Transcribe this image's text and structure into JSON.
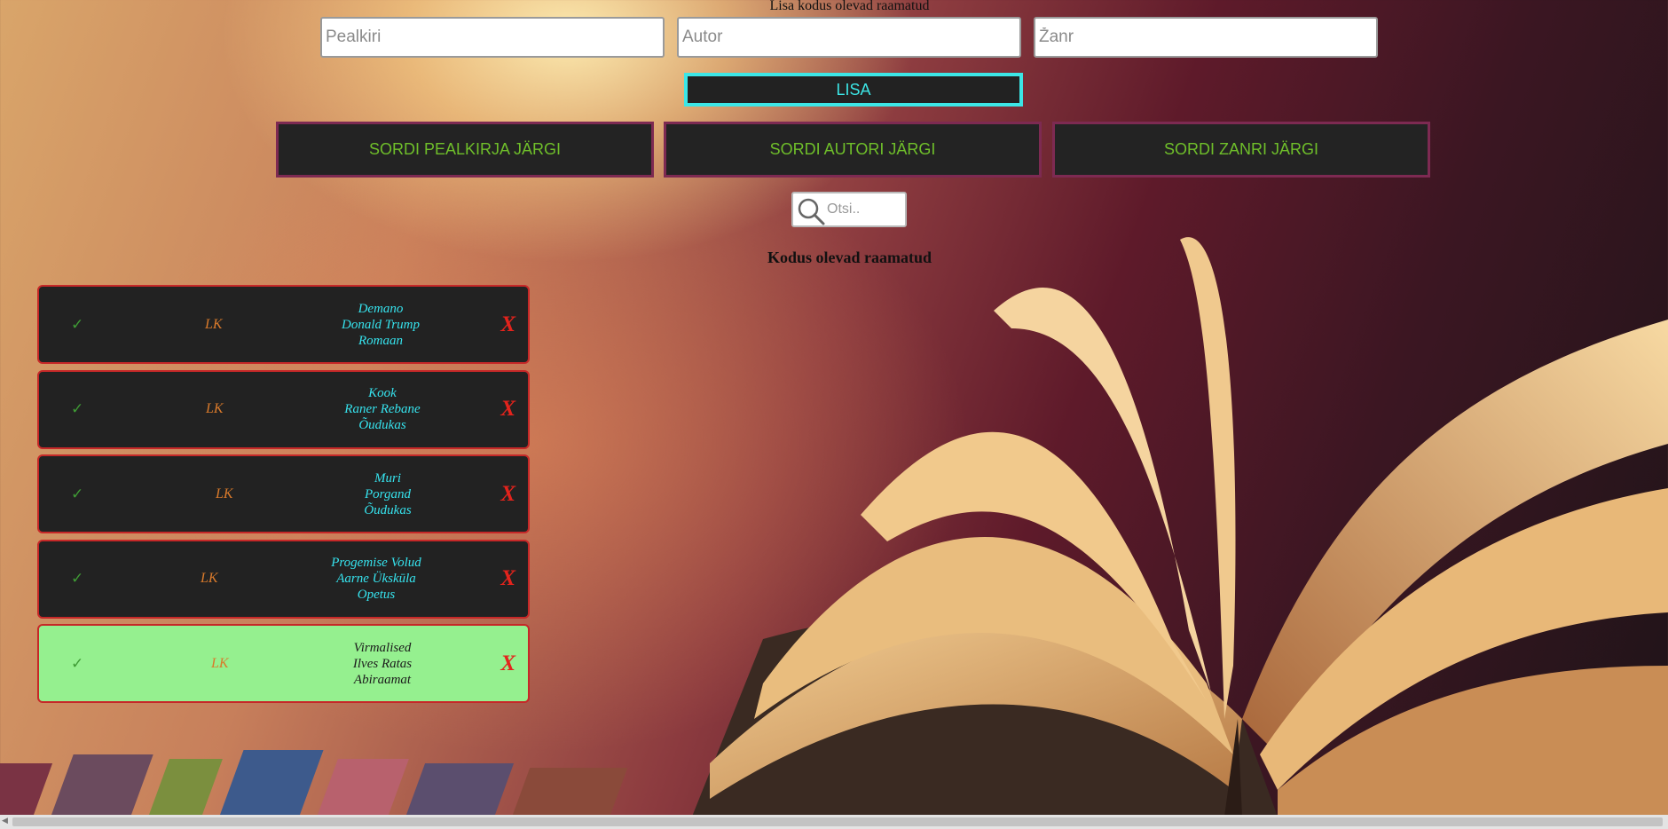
{
  "form": {
    "heading": "Lisa kodus olevad raamatud",
    "title_placeholder": "Pealkiri",
    "author_placeholder": "Autor",
    "genre_placeholder": "Žanr",
    "add_label": "LISA"
  },
  "sort": {
    "by_title": "SORDI PEALKIRJA JÄRGI",
    "by_author": "SORDI AUTORI JÄRGI",
    "by_genre": "SORDI ZANRI JÄRGI"
  },
  "search": {
    "placeholder": "Otsi..",
    "icon": "search-icon"
  },
  "list": {
    "heading": "Kodus olevad raamatud",
    "books": [
      {
        "check": "✓",
        "lk": "LK",
        "title": "Demano",
        "author": "Donald Trump",
        "genre": "Romaan",
        "delete": "X",
        "done": false
      },
      {
        "check": "✓",
        "lk": "LK",
        "title": "Kook",
        "author": "Raner Rebane",
        "genre": "Õudukas",
        "delete": "X",
        "done": false
      },
      {
        "check": "✓",
        "lk": "LK",
        "title": "Muri",
        "author": "Porgand",
        "genre": "Õudukas",
        "delete": "X",
        "done": false
      },
      {
        "check": "✓",
        "lk": "LK",
        "title": "Progemise Volud",
        "author": "Aarne Ükskūla",
        "genre": "Opetus",
        "delete": "X",
        "done": false
      },
      {
        "check": "✓",
        "lk": "LK",
        "title": "Virmalised",
        "author": "Ilves Ratas",
        "genre": "Abiraamat",
        "delete": "X",
        "done": true
      }
    ]
  },
  "colors": {
    "row_bg": "#222222",
    "row_done_bg": "#95f08f",
    "row_border": "#c62828",
    "info_text": "#36e3ee",
    "lk_text": "#d97a2b",
    "delete_text": "#e4231c",
    "sort_text": "#6fbf2a",
    "add_accent": "#3ce6e6"
  }
}
